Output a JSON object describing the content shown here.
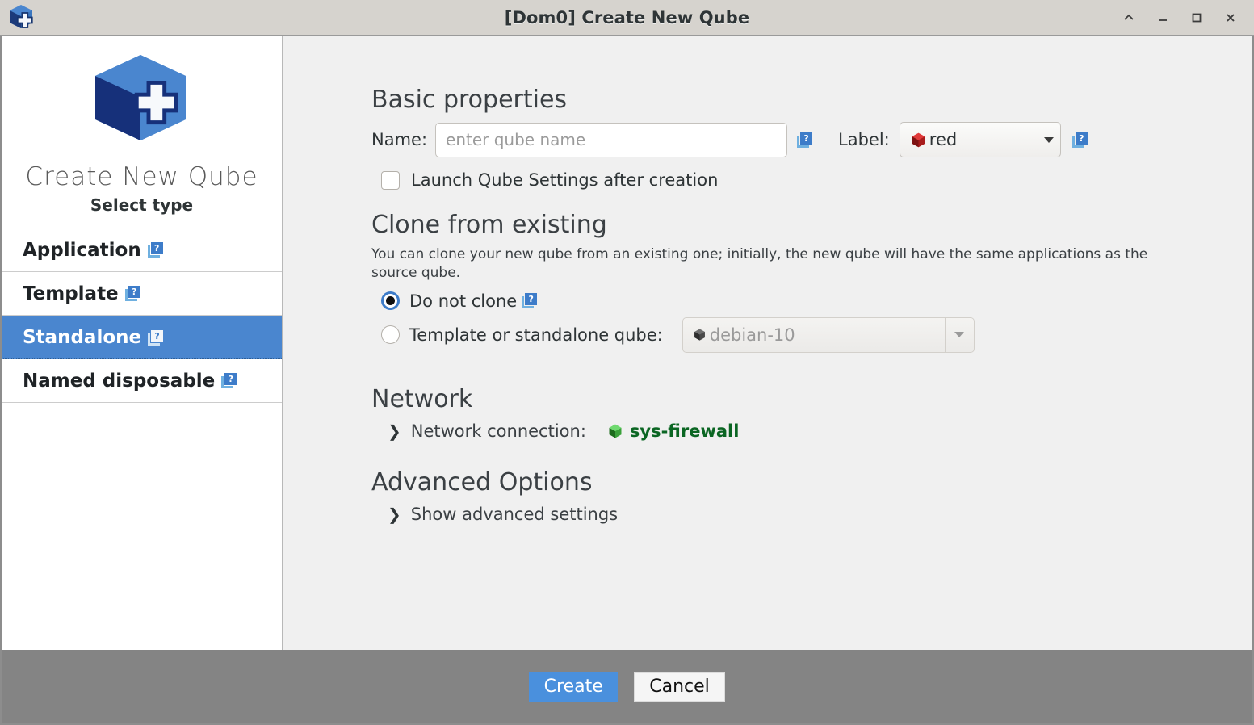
{
  "window": {
    "title": "[Dom0] Create New Qube",
    "icon": "qube-plus-icon",
    "controls": [
      {
        "name": "shade-button",
        "glyph": "chevron-up"
      },
      {
        "name": "minimize-button",
        "glyph": "minus"
      },
      {
        "name": "maximize-button",
        "glyph": "square"
      },
      {
        "name": "close-button",
        "glyph": "x"
      }
    ]
  },
  "sidebar": {
    "app_title": "Create New Qube",
    "app_subtitle": "Select type",
    "logo_icon": "qube-plus-logo",
    "items": [
      {
        "label": "Application",
        "selected": false,
        "help": "?"
      },
      {
        "label": "Template",
        "selected": false,
        "help": "?"
      },
      {
        "label": "Standalone",
        "selected": true,
        "help": "?"
      },
      {
        "label": "Named disposable",
        "selected": false,
        "help": "?"
      }
    ]
  },
  "main": {
    "basic": {
      "heading": "Basic properties",
      "name_label": "Name:",
      "name_value": "",
      "name_placeholder": "enter qube name",
      "name_help": "?",
      "label_label": "Label:",
      "label_value": "red",
      "label_color": "#cc2222",
      "label_help": "?",
      "launch_checkbox_label": "Launch Qube Settings after creation",
      "launch_checked": false
    },
    "clone": {
      "heading": "Clone from existing",
      "description": "You can clone your new qube from an existing one; initially, the new qube will have the same applications as the source qube.",
      "option_do_not_clone": "Do not clone",
      "option_do_not_clone_help": "?",
      "option_do_not_clone_selected": true,
      "option_template_label": "Template or standalone qube:",
      "option_template_selected": false,
      "template_combo_value": "debian-10",
      "template_combo_disabled": true
    },
    "network": {
      "heading": "Network",
      "connection_label": "Network connection:",
      "connection_value": "sys-firewall",
      "connection_color": "#0b6623",
      "expander_glyph": "chevron-right"
    },
    "advanced": {
      "heading": "Advanced Options",
      "show_label": "Show advanced settings",
      "expander_glyph": "chevron-right"
    }
  },
  "footer": {
    "create_label": "Create",
    "cancel_label": "Cancel",
    "create_color": "#4a90dd"
  }
}
